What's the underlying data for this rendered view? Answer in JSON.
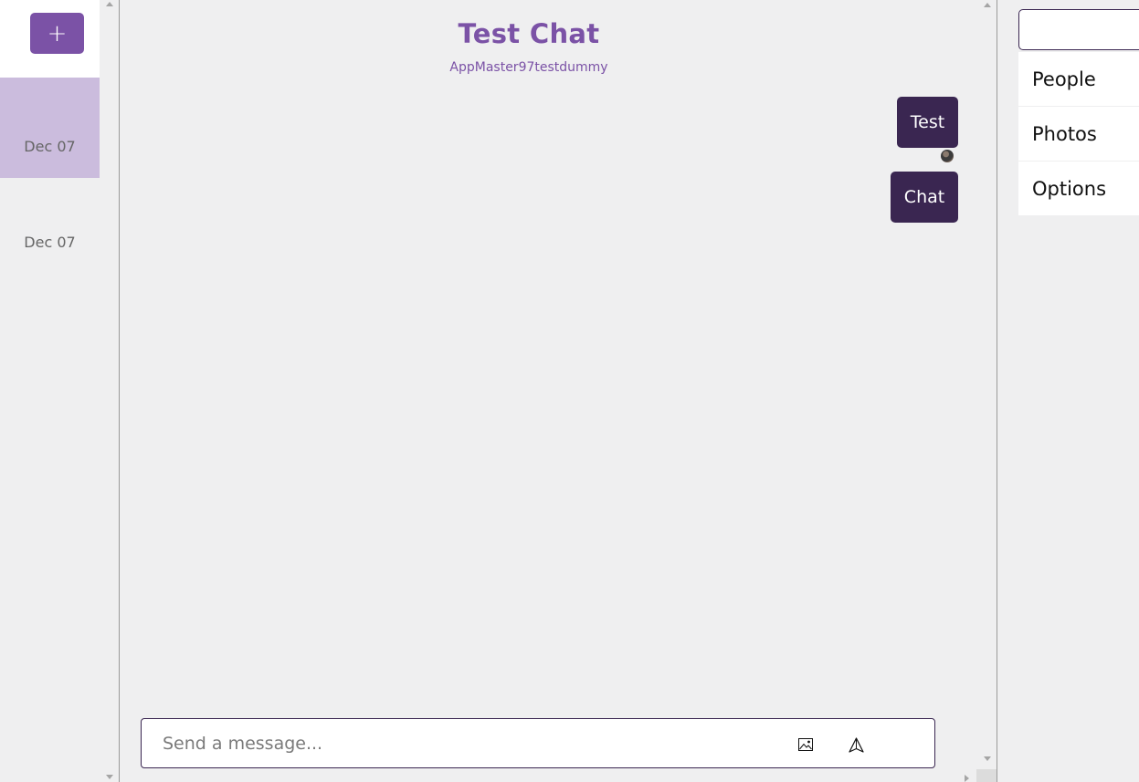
{
  "sidebar": {
    "new_chat_label": "+",
    "chats": [
      {
        "date": "Dec 07"
      },
      {
        "date": "Dec 07"
      }
    ]
  },
  "chat": {
    "title": "Test Chat",
    "subtitle": "AppMaster97testdummy",
    "messages": [
      {
        "text": "Test"
      },
      {
        "text": "Chat"
      }
    ],
    "composer": {
      "placeholder": "Send a message...",
      "value": ""
    }
  },
  "right_panel": {
    "search_value": "",
    "tabs": [
      {
        "label": "People"
      },
      {
        "label": "Photos"
      },
      {
        "label": "Options"
      }
    ]
  },
  "colors": {
    "accent": "#7b52a6",
    "bubble": "#3a2651",
    "selected_chat": "#cbbcdd",
    "background": "#efeff0"
  },
  "icons": [
    "plus-icon",
    "image-icon",
    "send-icon",
    "avatar",
    "scroll-arrow-up",
    "scroll-arrow-down"
  ]
}
